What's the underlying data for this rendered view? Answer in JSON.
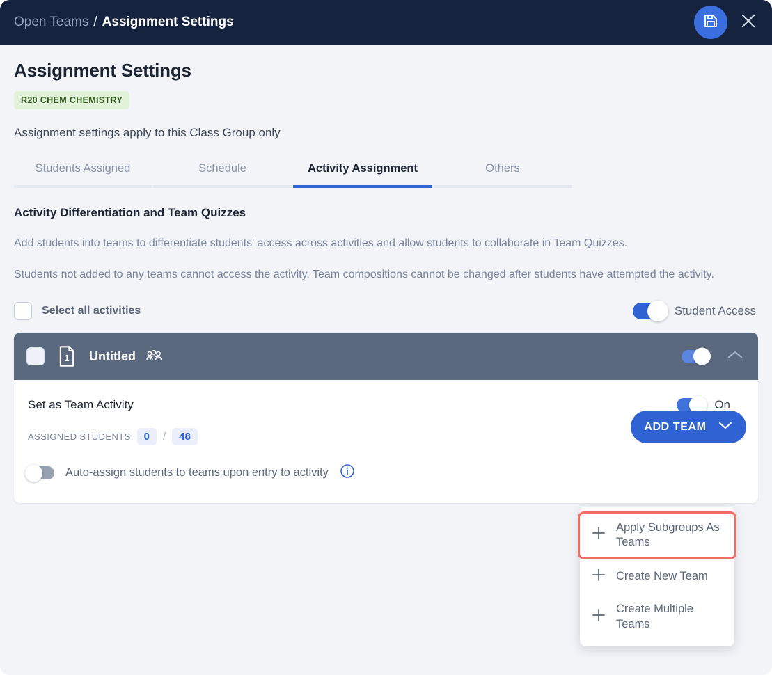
{
  "window": {
    "breadcrumb_parent": "Open Teams",
    "breadcrumb_separator": "/",
    "breadcrumb_current": "Assignment Settings",
    "save_icon": "floppy-disk-save-icon",
    "close_icon": "close-x-icon",
    "accent_color": "#2f63d4",
    "topbar_color": "#15233f"
  },
  "page": {
    "title": "Assignment Settings",
    "badge": "R20 CHEM CHEMISTRY",
    "badge_bg": "#e2f1d9",
    "badge_fg": "#33581f",
    "subtitle": "Assignment settings apply to this Class Group only"
  },
  "tabs": [
    {
      "label": "Students Assigned",
      "active": false
    },
    {
      "label": "Schedule",
      "active": false
    },
    {
      "label": "Activity Assignment",
      "active": true
    },
    {
      "label": "Others",
      "active": false
    }
  ],
  "section": {
    "title": "Activity Differentiation and Team Quizzes",
    "paragraph1": "Add students into teams to differentiate students' access across activities and allow students to collaborate in Team Quizzes.",
    "paragraph2": "Students not added to any teams cannot access the activity. Team compositions cannot be changed after students have attempted the activity."
  },
  "select_all": {
    "label": "Select all activities",
    "checked": false,
    "checkbox_icon": "checkbox-unchecked-icon"
  },
  "student_access": {
    "label": "Student Access",
    "state": "on",
    "toggle_icon": "toggle-on-icon"
  },
  "activity_card": {
    "header": {
      "checkbox_icon": "checkbox-unchecked-icon",
      "document_icon": "document-number-1-icon",
      "document_number": "1",
      "title": "Untitled",
      "users_icon": "users-group-icon",
      "toggle_state": "on",
      "toggle_icon": "toggle-on-icon",
      "collapse_icon": "chevron-up-icon",
      "bg_color": "#5b697f"
    },
    "team_activity": {
      "label": "Set as Team Activity",
      "toggle_state": "on",
      "toggle_icon": "toggle-on-icon",
      "state_label": "On"
    },
    "assigned_students": {
      "label": "ASSIGNED STUDENTS",
      "assigned": "0",
      "separator": "/",
      "total": "48"
    },
    "auto_assign": {
      "label": "Auto-assign students to teams upon entry to activity",
      "toggle_state": "off",
      "toggle_icon": "toggle-off-icon",
      "info_icon": "info-circle-icon"
    },
    "add_team_button": {
      "label": "ADD TEAM",
      "chevron_icon": "chevron-down-icon"
    }
  },
  "add_team_menu": {
    "items": [
      {
        "label": "Apply Subgroups As Teams",
        "icon": "plus-icon",
        "highlighted": true
      },
      {
        "label": "Create New Team",
        "icon": "plus-icon",
        "highlighted": false
      },
      {
        "label": "Create Multiple Teams",
        "icon": "plus-icon",
        "highlighted": false
      }
    ],
    "highlight_color": "#ef6e63"
  }
}
